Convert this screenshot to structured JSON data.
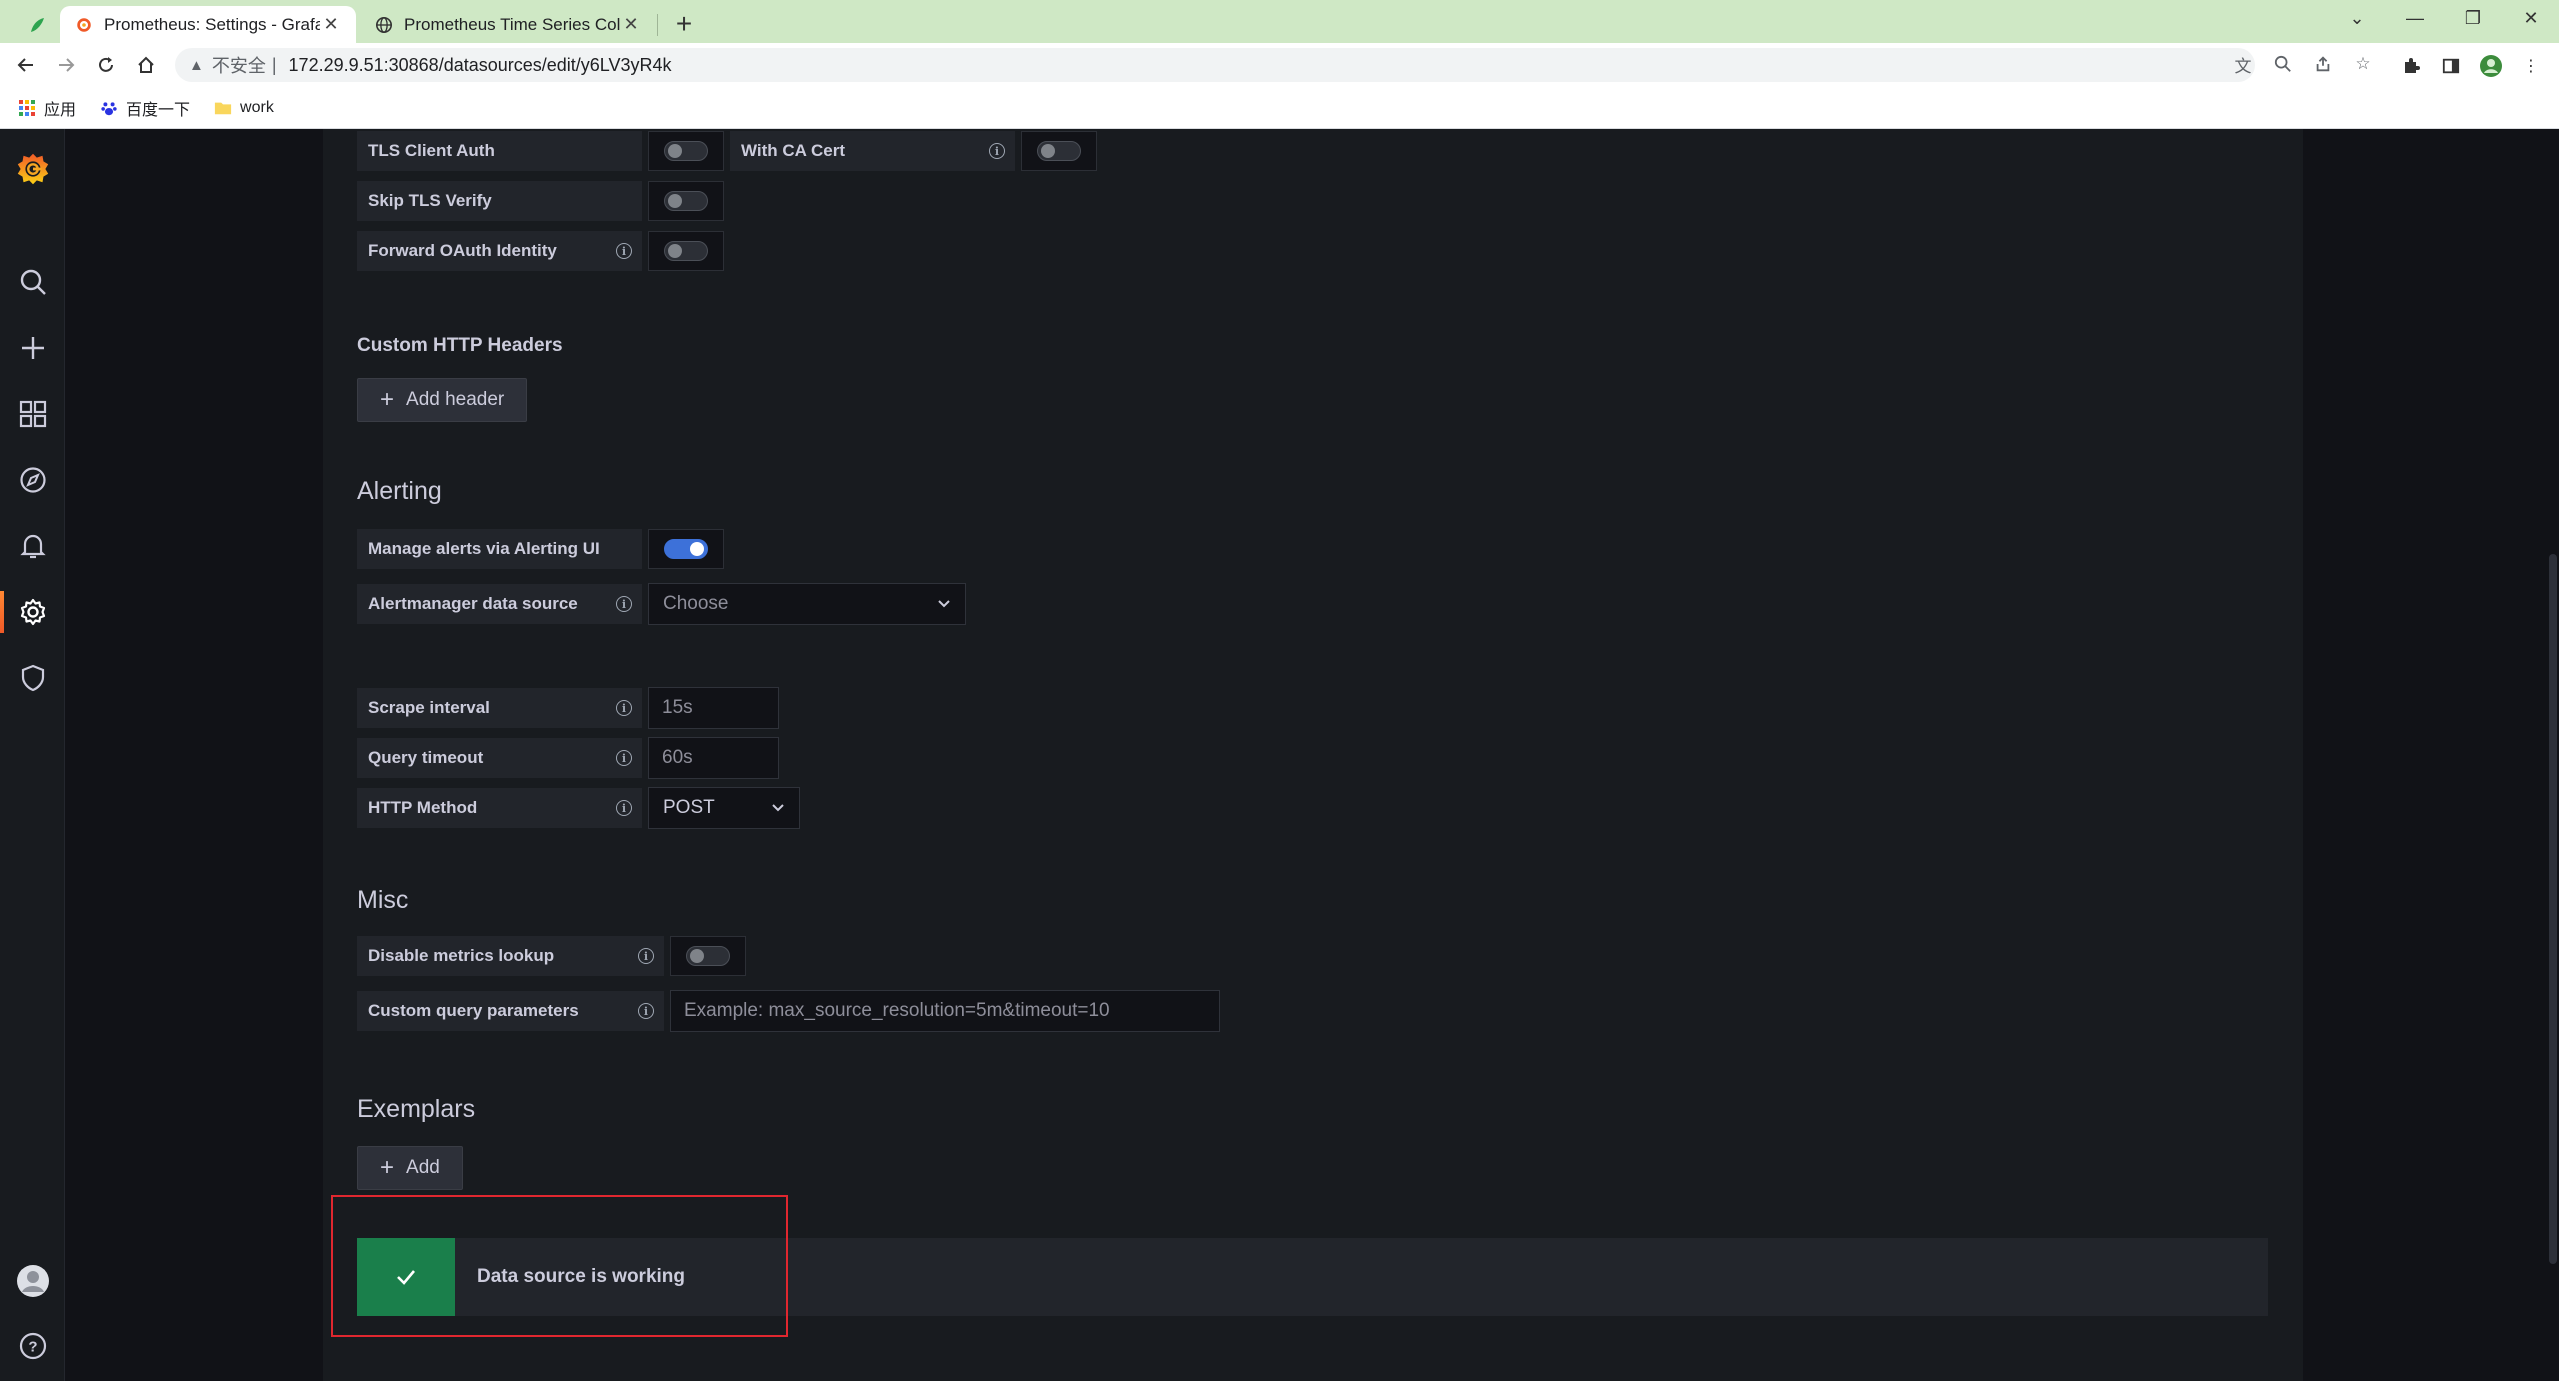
{
  "browser": {
    "tabs": [
      {
        "title": "Prometheus: Settings - Grafana",
        "active": true
      },
      {
        "title": "Prometheus Time Series Colle",
        "active": false
      }
    ],
    "address": {
      "insecure_label": "不安全",
      "url": "172.29.9.51:30868/datasources/edit/y6LV3yR4k"
    },
    "bookmarks": [
      {
        "label": "应用",
        "icon": "apps-grid-icon"
      },
      {
        "label": "百度一下",
        "icon": "baidu-paw-icon"
      },
      {
        "label": "work",
        "icon": "folder-icon"
      }
    ]
  },
  "tls": {
    "client_auth_label": "TLS Client Auth",
    "with_ca_cert_label": "With CA Cert",
    "skip_verify_label": "Skip TLS Verify",
    "forward_oauth_label": "Forward OAuth Identity"
  },
  "headers": {
    "title": "Custom HTTP Headers",
    "add_label": "Add header"
  },
  "alerting": {
    "title": "Alerting",
    "manage_label": "Manage alerts via Alerting UI",
    "manage_enabled": true,
    "am_source_label": "Alertmanager data source",
    "am_source_placeholder": "Choose"
  },
  "prometheus": {
    "scrape_label": "Scrape interval",
    "scrape_placeholder": "15s",
    "timeout_label": "Query timeout",
    "timeout_placeholder": "60s",
    "method_label": "HTTP Method",
    "method_value": "POST"
  },
  "misc": {
    "title": "Misc",
    "disable_lookup_label": "Disable metrics lookup",
    "custom_params_label": "Custom query parameters",
    "custom_params_placeholder": "Example: max_source_resolution=5m&timeout=10"
  },
  "exemplars": {
    "title": "Exemplars",
    "add_label": "Add"
  },
  "status": {
    "message": "Data source is working",
    "color": "#1a7f4b"
  },
  "colors": {
    "accent_blue": "#3d71d9",
    "grafana_orange": "#f05a28",
    "highlight_red": "#e0272f"
  }
}
